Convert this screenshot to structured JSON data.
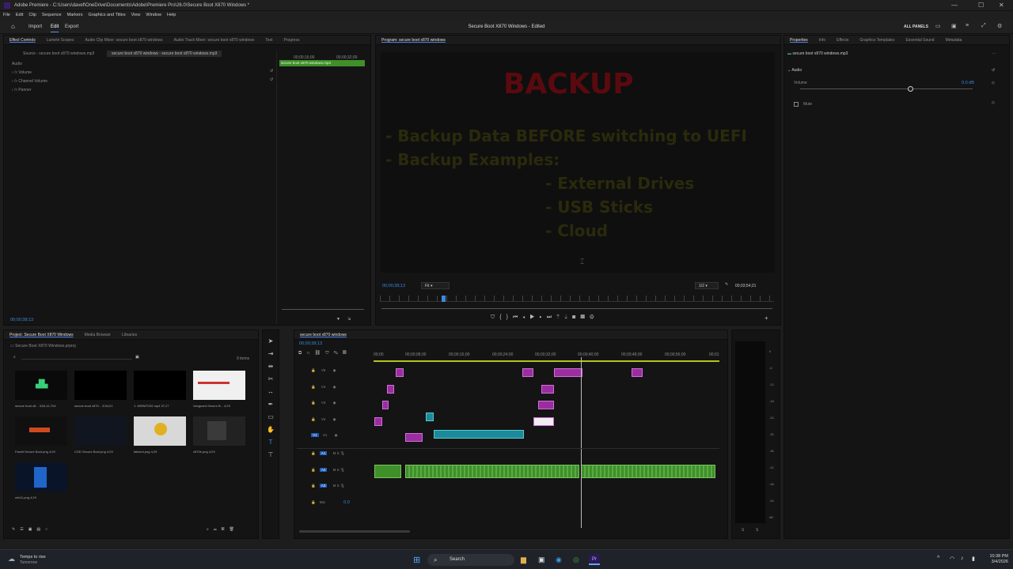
{
  "window": {
    "title": "Adobe Premiere - C:\\Users\\davef\\OneDrive\\Documents\\Adobe\\Premiere Pro\\26.0\\Secure Boot X870 Windows *",
    "controls": [
      "—",
      "☐",
      "✕"
    ]
  },
  "menu": [
    "File",
    "Edit",
    "Clip",
    "Sequence",
    "Markers",
    "Graphics and Titles",
    "View",
    "Window",
    "Help"
  ],
  "workspaces": {
    "import": "Import",
    "edit": "Edit",
    "export": "Export",
    "document": "Secure Boot X870 Windows - Edited",
    "all_panels": "ALL PANELS"
  },
  "effect_controls": {
    "tabs": [
      "Effect Controls",
      "Lumetri Scopes",
      "Audio Clip Mixer: secure boot x870 windows",
      "Audio Track Mixer: secure boot x870 windows",
      "Text",
      "Progress"
    ],
    "source_tab": "Source - secure boot x870 windows.mp3",
    "clip_tab": "secure boot x870 windows - secure boot x870 windows.mp3",
    "section": "Audio",
    "effects": [
      "Volume",
      "Channel Volume",
      "Panner"
    ],
    "ruler": [
      "00;00;16;00",
      "00;00;32;00"
    ],
    "clip_label": "secure boot x870 windows.mp3",
    "timecode": "00;00;38;13"
  },
  "program": {
    "tab": "Program: secure boot x870 windows",
    "slide": {
      "title": "BACKUP",
      "lines": [
        "- Backup Data BEFORE switching to UEFI",
        "- Backup Examples:"
      ],
      "sublines": [
        "- External Drives",
        "- USB Sticks",
        "- Cloud"
      ]
    },
    "timecode": "00;00;38;13",
    "fit": "Fit",
    "resolution": "1/2",
    "duration": "00;03;54;21"
  },
  "properties": {
    "tabs": [
      "Properties",
      "Info",
      "Effects",
      "Graphics Templates",
      "Essential Sound",
      "Metadata"
    ],
    "file": "secure boot x870 windows.mp3",
    "section": "Audio",
    "volume_label": "Volume",
    "volume_value": "0.0 dB",
    "mute_label": "Mute"
  },
  "project": {
    "tabs": [
      "Project: Secure Boot X870 Windows",
      "Media Browser",
      "Libraries"
    ],
    "path": "Secure Boot X870 Windows.prproj",
    "count": "9 items",
    "items": [
      {
        "name": "secure boot x8...",
        "dur": "3;54;11;704"
      },
      {
        "name": "secure boot x870...",
        "dur": "3;54;21"
      },
      {
        "name": "1. MSINFO32.mp4",
        "dur": "37;17"
      },
      {
        "name": "Vanguard Secure B...",
        "dur": "4;29"
      },
      {
        "name": "Faceit Secure Boot.png",
        "dur": "4;29"
      },
      {
        "name": "COD Secure Boot.png",
        "dur": "4;29"
      },
      {
        "name": "fallcbot.png",
        "dur": "4;29"
      },
      {
        "name": "x870e.png",
        "dur": "4;29"
      },
      {
        "name": "win11.png",
        "dur": "4;29"
      }
    ]
  },
  "timeline": {
    "tab": "secure boot x870 windows",
    "timecode": "00;00;38;13",
    "ruler": [
      "00;00",
      "00;00;08;00",
      "00;00;16;00",
      "00;00;24;00",
      "00;00;32;00",
      "00;00;40;00",
      "00;00;48;00",
      "00;00;56;00",
      "00;01"
    ],
    "video_tracks": [
      "V5",
      "V4",
      "V3",
      "V2",
      "V1"
    ],
    "audio_tracks": [
      "A1",
      "A2",
      "A3"
    ],
    "mix": "Mix",
    "mix_value": "0.0"
  },
  "meter": {
    "scale": [
      "0",
      "-6",
      "-12",
      "-18",
      "-24",
      "-30",
      "-36",
      "-42",
      "-48",
      "-54",
      "dB"
    ],
    "channels": [
      "S",
      "S"
    ]
  },
  "taskbar": {
    "weather": "Temps to rise",
    "weather_sub": "Tomorrow",
    "search": "Search",
    "time": "10:38 PM",
    "date": "3/4/2026"
  },
  "colors": {
    "accent": "#3c87e0",
    "clip_video": "#9a2ea0",
    "clip_audio": "#3f8f2a",
    "clip_text": "#1c8a9a",
    "slide_title": "#5a0a0f",
    "slide_text": "#2c2c10"
  }
}
